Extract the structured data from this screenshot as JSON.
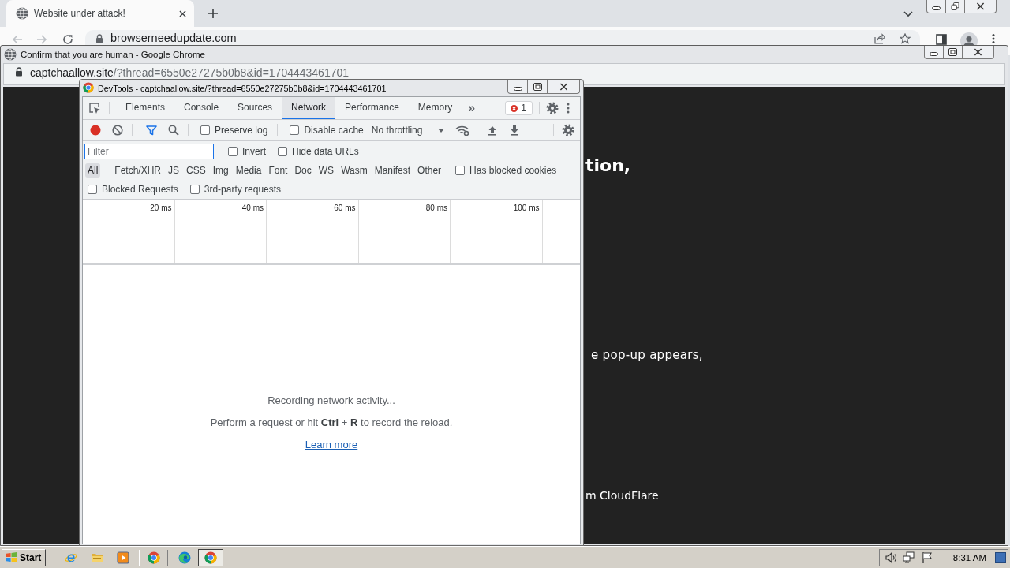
{
  "browser": {
    "tabs": [
      {
        "title": "Website under attack!",
        "selected": true
      }
    ],
    "address": "browserneedupdate.com"
  },
  "popup": {
    "title": "Confirm that you are human - Google Chrome",
    "address": {
      "host": "captchaallow.site",
      "path": "/?thread=6550e27275b0b8&id=1704443461701"
    },
    "page": [
      {
        "kind": "heading",
        "text": "tion,"
      },
      {
        "kind": "paragraph",
        "text": "e pop-up appears,"
      },
      {
        "kind": "divider"
      },
      {
        "kind": "footer",
        "text": "m CloudFlare"
      }
    ]
  },
  "devtools": {
    "title": "DevTools - captchaallow.site/?thread=6550e27275b0b8&id=1704443461701",
    "tabs": [
      {
        "label": "Elements",
        "selected": false
      },
      {
        "label": "Console",
        "selected": false
      },
      {
        "label": "Sources",
        "selected": false
      },
      {
        "label": "Network",
        "selected": true
      },
      {
        "label": "Performance",
        "selected": false
      },
      {
        "label": "Memory",
        "selected": false
      }
    ],
    "more_tabs": "»",
    "error_count": "1",
    "recording": true,
    "options": [
      {
        "label": "Preserve log",
        "checked": false
      },
      {
        "label": "Disable cache",
        "checked": false
      }
    ],
    "throttling": "No throttling",
    "filter": {
      "placeholder": "Filter",
      "focused": true
    },
    "filter_options": [
      {
        "label": "Invert",
        "checked": false
      },
      {
        "label": "Hide data URLs",
        "checked": false
      }
    ],
    "types": [
      {
        "label": "All",
        "selected": true
      },
      {
        "label": "Fetch/XHR",
        "selected": false
      },
      {
        "label": "JS",
        "selected": false
      },
      {
        "label": "CSS",
        "selected": false
      },
      {
        "label": "Img",
        "selected": false
      },
      {
        "label": "Media",
        "selected": false
      },
      {
        "label": "Font",
        "selected": false
      },
      {
        "label": "Doc",
        "selected": false
      },
      {
        "label": "WS",
        "selected": false
      },
      {
        "label": "Wasm",
        "selected": false
      },
      {
        "label": "Manifest",
        "selected": false
      },
      {
        "label": "Other",
        "selected": false
      }
    ],
    "cookie_option": {
      "label": "Has blocked cookies",
      "checked": false
    },
    "request_options": [
      {
        "label": "Blocked Requests",
        "checked": false
      },
      {
        "label": "3rd-party requests",
        "checked": false
      }
    ],
    "timeline_ticks": [
      "20 ms",
      "40 ms",
      "60 ms",
      "80 ms",
      "100 ms"
    ],
    "empty_state": {
      "title": "Recording network activity...",
      "hint": "Perform a request or hit **Ctrl** + **R** to record the reload.",
      "link": "Learn more"
    }
  },
  "taskbar": {
    "start": "Start",
    "buttons": [
      {
        "kind": "ie",
        "selected": false
      },
      {
        "kind": "folder",
        "selected": false
      },
      {
        "kind": "media",
        "selected": false
      },
      {
        "kind": "chrome",
        "selected": false
      },
      {
        "kind": "edge",
        "selected": false
      },
      {
        "kind": "chrome",
        "selected": true
      }
    ],
    "clock": "8:31 AM"
  }
}
